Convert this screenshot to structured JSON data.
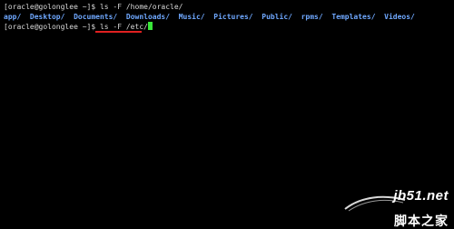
{
  "terminal": {
    "lines": [
      {
        "prompt": "[oracle@golonglee ~]$ ",
        "command": "ls -F /home/oracle/"
      },
      {
        "prompt": "[oracle@golonglee ~]$ ",
        "command": "ls -F /etc/"
      }
    ],
    "listing": [
      "app/",
      "Desktop/",
      "Documents/",
      "Downloads/",
      "Music/",
      "Pictures/",
      "Public/",
      "rpms/",
      "Templates/",
      "Videos/"
    ],
    "separator": "  "
  },
  "watermark": {
    "url": "jb51.net",
    "name": "脚本之家"
  },
  "colors": {
    "background": "#000000",
    "text": "#d8d8d8",
    "directory": "#6fa8ff",
    "cursor": "#39e639",
    "annotation": "#e02020"
  }
}
